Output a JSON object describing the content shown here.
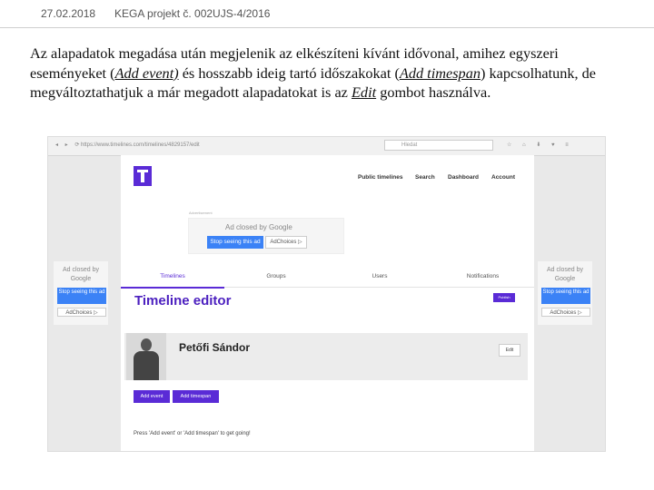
{
  "slide": {
    "date": "27.02.2018",
    "project": "KEGA projekt č. 002UJS-4/2016",
    "text": {
      "p1": "Az alapadatok megadása után megjelenik az elkészíteni kívánt idővonal, amihez egyszeri eseményeket (",
      "add_event": "Add event)",
      "p2": " és hosszabb ideig tartó időszakokat (",
      "add_timespan": "Add timespan",
      "p3": ") kapcsolhatunk, de megváltoztathatjuk a már megadott alapadatokat is az ",
      "edit": "Edit",
      "p4": " gombot használva."
    }
  },
  "browser": {
    "nav_icons": "◂ ▸ ⟳",
    "url": "https://www.timelines.com/timelines/4829157/edit",
    "search_placeholder": "Hledat",
    "tools": "☆ ⌂ ⬇ ♥ ≡",
    "site": {
      "nav": [
        "Public timelines",
        "Search",
        "Dashboard",
        "Account"
      ],
      "ad_label": "Advertisement",
      "ad": {
        "closed_by": "Ad closed by Google",
        "stop": "Stop seeing this ad",
        "choices": "AdChoices ▷"
      },
      "tabs": [
        "Timelines",
        "Groups",
        "Users",
        "Notifications"
      ],
      "editor_title": "Timeline editor",
      "publish": "Publish",
      "person_name": "Petőfi Sándor",
      "edit_button": "Edit",
      "add_event": "Add event",
      "add_timespan": "Add timespan",
      "hint": "Press 'Add event' or 'Add timespan' to get going!"
    },
    "side_ad": {
      "closed_by": "Ad closed by Google",
      "stop": "Stop seeing this ad",
      "choices": "AdChoices ▷"
    }
  }
}
